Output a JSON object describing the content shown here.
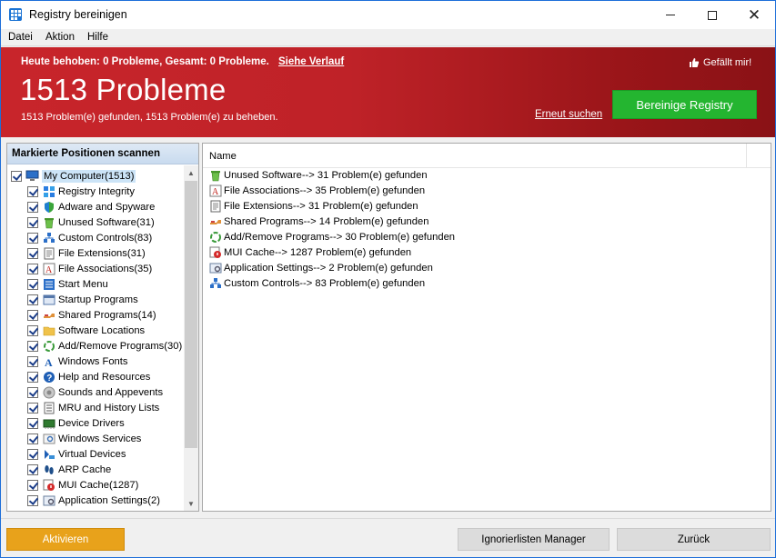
{
  "window": {
    "title": "Registry bereinigen",
    "icon": "grid-app-icon"
  },
  "menu": [
    "Datei",
    "Aktion",
    "Hilfe"
  ],
  "banner": {
    "status_line": "Heute behoben: 0 Probleme, Gesamt: 0 Probleme.",
    "history_link": "Siehe Verlauf",
    "like_label": "Gefällt mir!",
    "headline": "1513 Probleme",
    "summary": "1513 Problem(e) gefunden, 1513 Problem(e) zu beheben.",
    "rescan_link": "Erneut suchen",
    "clean_button": "Bereinige Registry",
    "colors": {
      "banner": "#c8252b",
      "clean_button": "#24b530"
    }
  },
  "scan_panel": {
    "header": "Markierte Positionen scannen",
    "root": {
      "label": "My Computer(1513)",
      "icon": "computer-icon",
      "checked": true
    },
    "items": [
      {
        "label": "Registry Integrity",
        "icon": "blocks-icon",
        "checked": true
      },
      {
        "label": "Adware and Spyware",
        "icon": "shield-icon",
        "checked": true
      },
      {
        "label": "Unused Software(31)",
        "icon": "recycle-bin-icon",
        "checked": true
      },
      {
        "label": "Custom Controls(83)",
        "icon": "controls-icon",
        "checked": true
      },
      {
        "label": "File Extensions(31)",
        "icon": "file-list-icon",
        "checked": true
      },
      {
        "label": "File Associations(35)",
        "icon": "file-association-icon",
        "checked": true
      },
      {
        "label": "Start Menu",
        "icon": "start-menu-icon",
        "checked": true
      },
      {
        "label": "Startup Programs",
        "icon": "startup-icon",
        "checked": true
      },
      {
        "label": "Shared Programs(14)",
        "icon": "shared-programs-icon",
        "checked": true
      },
      {
        "label": "Software Locations",
        "icon": "folder-icon",
        "checked": true
      },
      {
        "label": "Add/Remove Programs(30)",
        "icon": "add-remove-icon",
        "checked": true
      },
      {
        "label": "Windows Fonts",
        "icon": "font-icon",
        "checked": true
      },
      {
        "label": "Help and Resources",
        "icon": "help-icon",
        "checked": true
      },
      {
        "label": "Sounds and Appevents",
        "icon": "speaker-icon",
        "checked": true
      },
      {
        "label": "MRU and History Lists",
        "icon": "history-list-icon",
        "checked": true
      },
      {
        "label": "Device Drivers",
        "icon": "driver-icon",
        "checked": true
      },
      {
        "label": "Windows Services",
        "icon": "services-icon",
        "checked": true
      },
      {
        "label": "Virtual Devices",
        "icon": "virtual-device-icon",
        "checked": true
      },
      {
        "label": "ARP Cache",
        "icon": "footprints-icon",
        "checked": true
      },
      {
        "label": "MUI Cache(1287)",
        "icon": "mui-cache-icon",
        "checked": true
      },
      {
        "label": "Application Settings(2)",
        "icon": "app-settings-icon",
        "checked": true
      }
    ]
  },
  "results_panel": {
    "column_header": "Name",
    "rows": [
      {
        "text": "Unused Software--> 31 Problem(e) gefunden",
        "icon": "recycle-bin-icon"
      },
      {
        "text": "File Associations--> 35 Problem(e) gefunden",
        "icon": "file-association-icon"
      },
      {
        "text": "File Extensions--> 31 Problem(e) gefunden",
        "icon": "file-list-icon"
      },
      {
        "text": "Shared Programs--> 14 Problem(e) gefunden",
        "icon": "shared-programs-icon"
      },
      {
        "text": "Add/Remove Programs--> 30 Problem(e) gefunden",
        "icon": "add-remove-icon"
      },
      {
        "text": "MUI Cache--> 1287 Problem(e) gefunden",
        "icon": "mui-cache-icon"
      },
      {
        "text": "Application Settings--> 2 Problem(e) gefunden",
        "icon": "app-settings-icon"
      },
      {
        "text": "Custom Controls--> 83 Problem(e) gefunden",
        "icon": "controls-icon"
      }
    ]
  },
  "footer": {
    "activate_button": "Aktivieren",
    "ignore_button": "Ignorierlisten Manager",
    "back_button": "Zurück",
    "colors": {
      "activate": "#e8a21b"
    }
  }
}
